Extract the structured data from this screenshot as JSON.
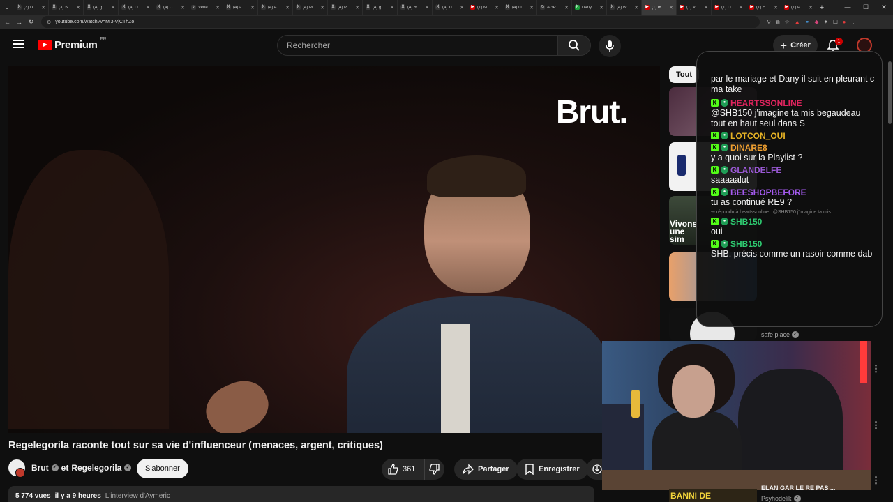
{
  "browser": {
    "tabs": [
      {
        "label": "(3) D",
        "fav": "X",
        "color": "#333"
      },
      {
        "label": "(3) S",
        "fav": "X",
        "color": "#333"
      },
      {
        "label": "(4) g",
        "fav": "X",
        "color": "#333"
      },
      {
        "label": "(4) Li",
        "fav": "X",
        "color": "#333"
      },
      {
        "label": "(4) C",
        "fav": "X",
        "color": "#333"
      },
      {
        "label": "Vene",
        "fav": "♪",
        "color": "#333"
      },
      {
        "label": "(4) a",
        "fav": "X",
        "color": "#333"
      },
      {
        "label": "(4) A",
        "fav": "X",
        "color": "#333"
      },
      {
        "label": "(4) M",
        "fav": "X",
        "color": "#333"
      },
      {
        "label": "(4) Pi",
        "fav": "X",
        "color": "#333"
      },
      {
        "label": "(4) g",
        "fav": "X",
        "color": "#333"
      },
      {
        "label": "(4) R",
        "fav": "X",
        "color": "#333"
      },
      {
        "label": "(4) Ti",
        "fav": "X",
        "color": "#333"
      },
      {
        "label": "(1) M",
        "fav": "▶",
        "color": "#cc0000"
      },
      {
        "label": "(4) Li",
        "fav": "X",
        "color": "#333"
      },
      {
        "label": "AGP",
        "fav": "◎",
        "color": "#333"
      },
      {
        "label": "Dany",
        "fav": "K",
        "color": "#1a9e3a"
      },
      {
        "label": "(4) Br",
        "fav": "X",
        "color": "#333"
      },
      {
        "label": "(1) R",
        "fav": "▶",
        "color": "#cc0000",
        "active": true
      },
      {
        "label": "(1) V",
        "fav": "▶",
        "color": "#cc0000"
      },
      {
        "label": "(1) Li",
        "fav": "▶",
        "color": "#cc0000"
      },
      {
        "label": "(1) F",
        "fav": "▶",
        "color": "#cc0000"
      },
      {
        "label": "(1) P",
        "fav": "▶",
        "color": "#cc0000"
      }
    ],
    "url": "youtube.com/watch?v=Mj3-VjCThZo"
  },
  "header": {
    "brand": "Premium",
    "country": "FR",
    "search_placeholder": "Rechercher",
    "create_label": "Créer",
    "notification_count": "1"
  },
  "video": {
    "watermark": "Brut.",
    "title": "Regelegorila raconte tout sur sa vie d'influenceur (menaces, argent, critiques)",
    "channel_1": "Brut",
    "channel_join": "et",
    "channel_2": "Regelegorila",
    "subscribe_label": "S'abonner",
    "likes": "361",
    "share_label": "Partager",
    "save_label": "Enregistrer",
    "views": "5 774 vues",
    "age": "il y a 9 heures",
    "tag": "L'interview d'Aymeric"
  },
  "sidebar": {
    "chip": "Tout",
    "thumb_titles": [
      "Vivons une sim"
    ],
    "channel_label": "safe place",
    "bottom_thumb_text": "BANNI DE",
    "bottom_title": "ELAN GAR LE RE PAS ...",
    "bottom_channel": "Psyhodelik"
  },
  "chat": {
    "top_text": "par le mariage et Dany il suit en pleurant c ma take",
    "messages": [
      {
        "user": "HEARTSSONLINE",
        "color": "#e0245e",
        "text": "@SHB150 j'imagine ta mis begaudeau tout en haut seul dans S"
      },
      {
        "user": "LOTCON_OUI",
        "color": "#e6b325",
        "text": ""
      },
      {
        "user": "DINARE8",
        "color": "#f0a030",
        "text": "y a quoi sur la Playlist ?"
      },
      {
        "user": "GLANDELFE",
        "color": "#9b59d6",
        "text": "saaaaalut"
      },
      {
        "user": "BEESHOPBEFORE",
        "color": "#a55bf0",
        "text": "tu as continué RE9 ?"
      },
      {
        "user": "SHB150",
        "color": "#2ecc71",
        "reply": "↪ répondu à heartssonline : @SHB150 j'imagine ta mis",
        "text": "oui"
      },
      {
        "user": "SHB150",
        "color": "#2ecc71",
        "text": "SHB. précis comme un rasoir comme dab"
      }
    ]
  }
}
